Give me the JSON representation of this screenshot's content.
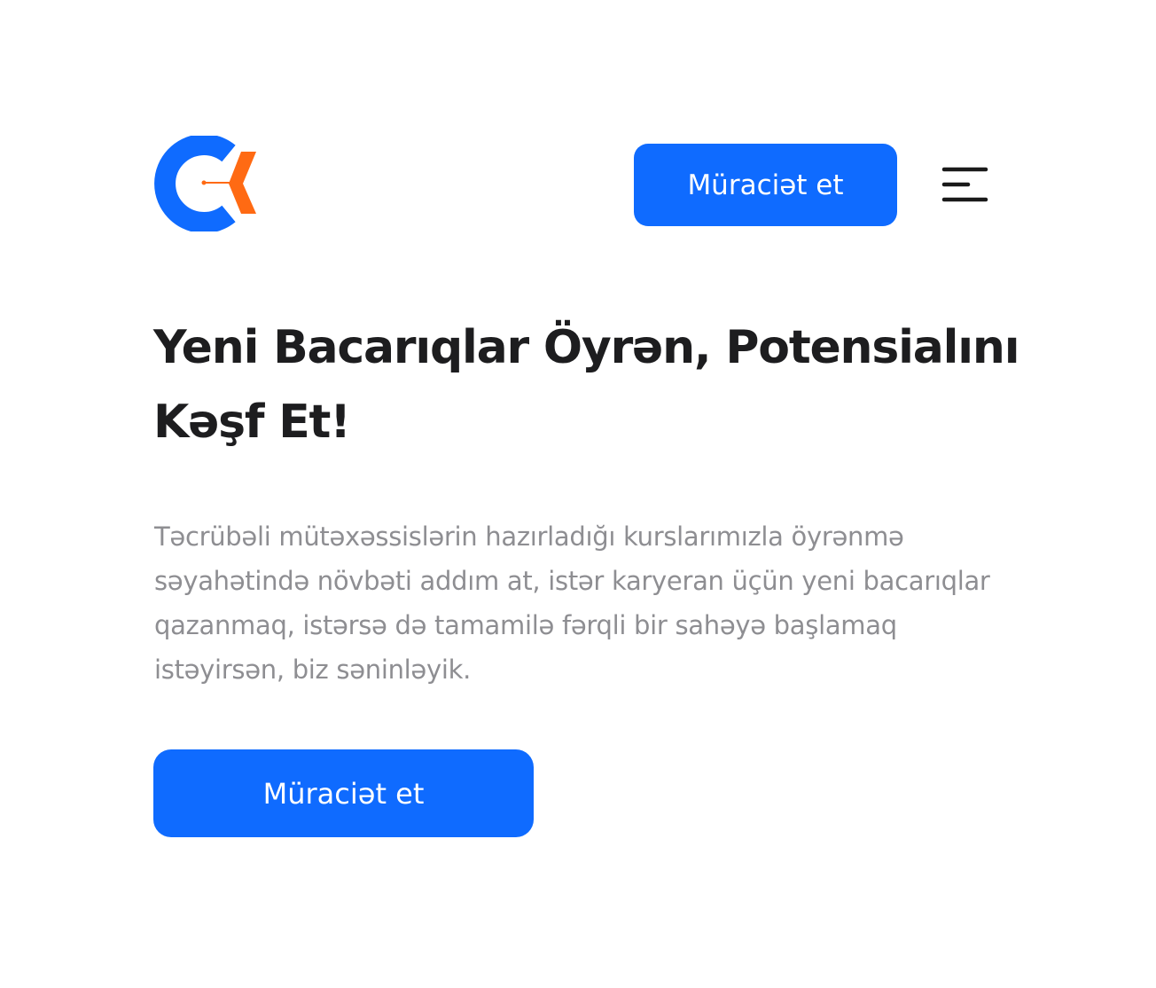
{
  "header": {
    "logo": {
      "icon": "company-logo-icon",
      "colors": {
        "primary": "#0f6bff",
        "accent": "#ff6a13"
      }
    },
    "apply_button_label": "Müraciət et",
    "menu_icon": "hamburger-menu-icon"
  },
  "hero": {
    "title": "Yeni Bacarıqlar Öyrən, Potensialını Kəşf Et!",
    "description": "Təcrübəli mütəxəssislərin hazırladığı kurslarımızla öyrənmə səyahətində növbəti addım at, istər karyeran üçün yeni bacarıqlar qazanmaq, istərsə də tamamilə fərqli bir sahəyə başlamaq istəyirsən, biz səninləyik.",
    "cta_button_label": "Müraciət et"
  },
  "colors": {
    "brand_blue": "#0f6bff",
    "brand_orange": "#ff6a13",
    "heading": "#1d1d1f",
    "body_text": "#8e8e92",
    "background": "#ffffff"
  }
}
